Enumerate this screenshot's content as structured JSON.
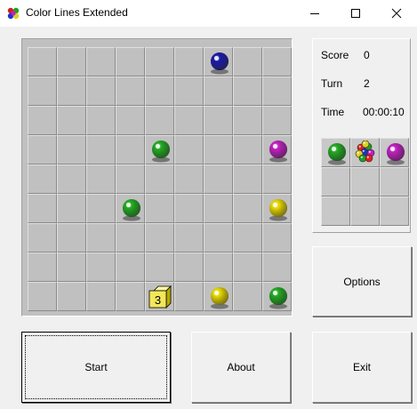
{
  "window": {
    "title": "Color Lines Extended"
  },
  "colors": {
    "green": "#22aa22",
    "blue": "#1a1aa8",
    "magenta": "#c020c0",
    "yellow": "#e6d800",
    "tile": "#f2e85a"
  },
  "board": {
    "rows": 9,
    "cols": 9,
    "balls": [
      {
        "row": 0,
        "col": 6,
        "color": "blue"
      },
      {
        "row": 3,
        "col": 4,
        "color": "green"
      },
      {
        "row": 3,
        "col": 8,
        "color": "magenta"
      },
      {
        "row": 5,
        "col": 3,
        "color": "green"
      },
      {
        "row": 5,
        "col": 8,
        "color": "yellow"
      },
      {
        "row": 8,
        "col": 6,
        "color": "yellow"
      },
      {
        "row": 8,
        "col": 8,
        "color": "green"
      }
    ],
    "tile": {
      "row": 8,
      "col": 4,
      "label": "3"
    }
  },
  "stats": {
    "score_label": "Score",
    "score_value": "0",
    "turn_label": "Turn",
    "turn_value": "2",
    "time_label": "Time",
    "time_value": "00:00:10"
  },
  "next_balls": [
    "green",
    "multicolor",
    "magenta"
  ],
  "buttons": {
    "options": "Options",
    "start": "Start",
    "about": "About",
    "exit": "Exit"
  }
}
